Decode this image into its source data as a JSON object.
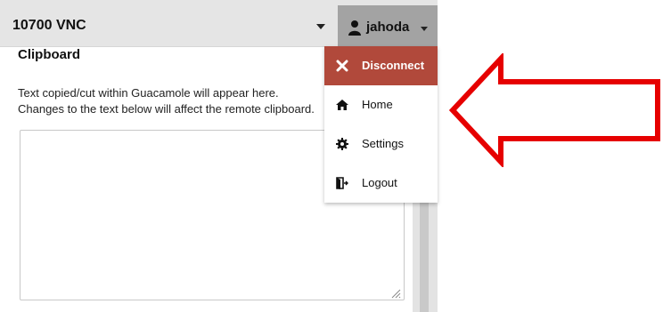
{
  "header": {
    "connection_name": "10700 VNC",
    "username": "jahoda"
  },
  "clipboard": {
    "title": "Clipboard",
    "description": "Text copied/cut within Guacamole will appear here. Changes to the text below will affect the remote clipboard.",
    "value": ""
  },
  "user_menu": {
    "items": [
      {
        "label": "Disconnect",
        "icon": "close-icon"
      },
      {
        "label": "Home",
        "icon": "home-icon"
      },
      {
        "label": "Settings",
        "icon": "gear-icon"
      },
      {
        "label": "Logout",
        "icon": "logout-icon"
      }
    ]
  },
  "colors": {
    "header_bg": "#e5e5e5",
    "user_button_bg": "#a3a3a3",
    "disconnect_bg": "#b1493b",
    "arrow": "#e60000"
  }
}
